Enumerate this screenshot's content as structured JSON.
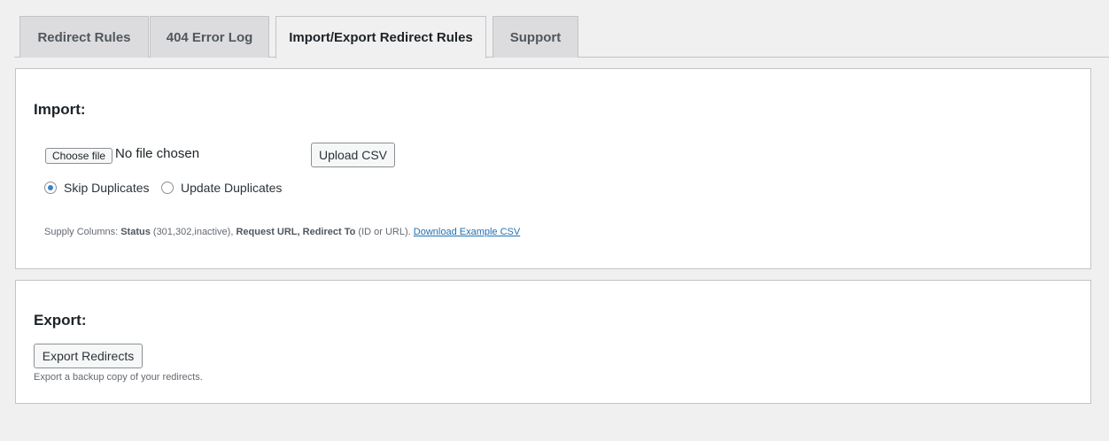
{
  "tabs": [
    {
      "label": "Redirect Rules",
      "active": false
    },
    {
      "label": "404 Error Log",
      "active": false
    },
    {
      "label": "Import/Export Redirect Rules",
      "active": true
    },
    {
      "label": "Support",
      "active": false
    }
  ],
  "import": {
    "title": "Import:",
    "choose_file_label": "Choose file",
    "file_status": "No file chosen",
    "upload_label": "Upload CSV",
    "radio_skip_label": "Skip Duplicates",
    "radio_update_label": "Update Duplicates",
    "selected_option": "Skip Duplicates",
    "help": {
      "prefix": "Supply Columns: ",
      "status_label": "Status",
      "status_detail": " (301,302,inactive), ",
      "request_url_label": "Request URL",
      "separator": ", ",
      "redirect_to_label": "Redirect To",
      "redirect_detail": " (ID or URL). ",
      "download_link": "Download Example CSV"
    }
  },
  "export": {
    "title": "Export:",
    "button_label": "Export Redirects",
    "help": "Export a backup copy of your redirects."
  },
  "colors": {
    "accent": "#2271b1",
    "radio_checked": "#3582c4",
    "background": "#f0f0f1"
  }
}
